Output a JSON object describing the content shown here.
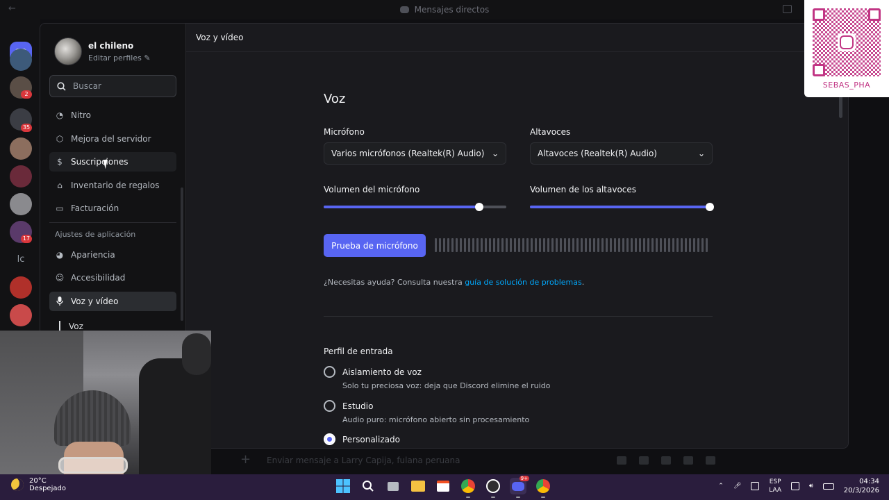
{
  "window": {
    "title": "Mensajes directos"
  },
  "guilds": {
    "badges": [
      "2",
      "35",
      "17"
    ],
    "text_guild": "lc"
  },
  "user": {
    "name": "el chileno",
    "edit_label": "Editar perfiles"
  },
  "search": {
    "placeholder": "Buscar"
  },
  "sidebar": {
    "items_top": [
      {
        "label": "Nitro",
        "icon": "nitro-icon"
      },
      {
        "label": "Mejora del servidor",
        "icon": "boost-icon"
      },
      {
        "label": "Suscripciones",
        "icon": "subscriptions-icon"
      },
      {
        "label": "Inventario de regalos",
        "icon": "gift-icon"
      },
      {
        "label": "Facturación",
        "icon": "credit-card-icon"
      }
    ],
    "section_title": "Ajustes de aplicación",
    "items_app": [
      {
        "label": "Apariencia",
        "icon": "palette-icon"
      },
      {
        "label": "Accesibilidad",
        "icon": "accessibility-icon"
      },
      {
        "label": "Voz y vídeo",
        "icon": "microphone-icon"
      }
    ],
    "sub_item": "Voz"
  },
  "header": {
    "title": "Voz y vídeo"
  },
  "voice": {
    "heading": "Voz",
    "mic_label": "Micrófono",
    "mic_value": "Varios micrófonos (Realtek(R) Audio)",
    "speaker_label": "Altavoces",
    "speaker_value": "Altavoces (Realtek(R) Audio)",
    "mic_volume_label": "Volumen del micrófono",
    "mic_volume": 0.85,
    "speaker_volume_label": "Volumen de los altavoces",
    "speaker_volume": 1.0,
    "test_button": "Prueba de micrófono",
    "help_text": "¿Necesitas ayuda? Consulta nuestra ",
    "help_link": "guía de solución de problemas",
    "help_end": "."
  },
  "input_profile": {
    "title": "Perfil de entrada",
    "options": [
      {
        "title": "Aislamiento de voz",
        "desc": "Solo tu preciosa voz: deja que Discord elimine el ruido",
        "selected": false
      },
      {
        "title": "Estudio",
        "desc": "Audio puro: micrófono abierto sin procesamiento",
        "selected": false
      },
      {
        "title": "Personalizado",
        "desc": "",
        "selected": true
      }
    ]
  },
  "chat": {
    "placeholder": "Enviar mensaje a Larry Capija, fulana peruana"
  },
  "overlay_qr": {
    "tag": "SEBAS_PHA"
  },
  "taskbar": {
    "temp": "20°C",
    "weather": "Despejado",
    "lang_top": "ESP",
    "lang_bottom": "LAA",
    "time": "04:34",
    "date": "20/3/2026",
    "discord_badge": "9+"
  },
  "colors": {
    "accent": "#5865f2",
    "link": "#00a8fc",
    "qr": "#c13584",
    "taskbar": "#2a1d3d"
  }
}
